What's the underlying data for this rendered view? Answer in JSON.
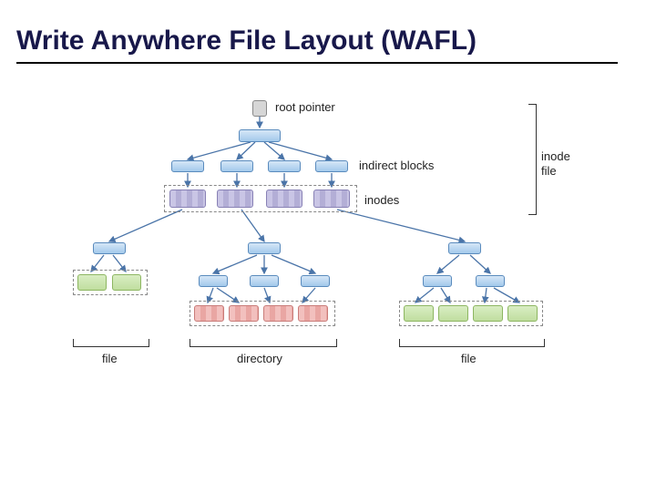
{
  "title": "Write Anywhere File Layout (WAFL)",
  "labels": {
    "root_pointer": "root pointer",
    "indirect_blocks": "indirect blocks",
    "inodes": "inodes",
    "inode_file": "inode\nfile",
    "file_left": "file",
    "directory": "directory",
    "file_right": "file"
  },
  "colors": {
    "title": "#18184a",
    "blue_fill": "#a3c9eb",
    "green_fill": "#c0de9f",
    "purple_fill": "#c9c5e5",
    "red_fill": "#f2c0be",
    "gray_fill": "#d6d6d6"
  },
  "layout": {
    "levels": [
      {
        "name": "root-pointer",
        "count": 1
      },
      {
        "name": "indirect-block",
        "count": 1
      },
      {
        "name": "indirect-block-row",
        "count": 4
      },
      {
        "name": "inodes",
        "count": 4
      },
      {
        "name": "file-indirect",
        "count": 6
      },
      {
        "name": "data-blocks",
        "groups": 3
      }
    ],
    "bottom_groups": [
      {
        "type": "file",
        "blocks": 2,
        "style": "green"
      },
      {
        "type": "directory",
        "blocks": 4,
        "style": "red-striped"
      },
      {
        "type": "file",
        "blocks": 4,
        "style": "green"
      }
    ]
  }
}
